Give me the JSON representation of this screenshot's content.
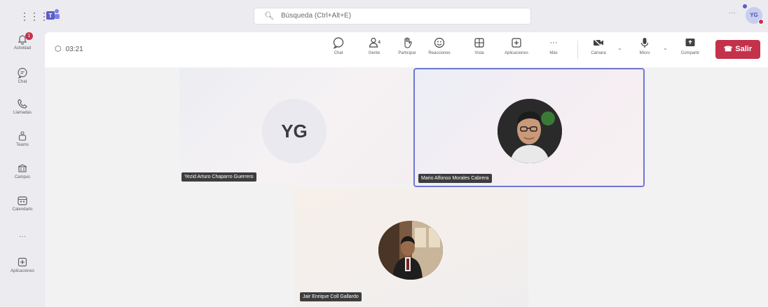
{
  "topbar": {
    "search_placeholder": "Búsqueda (Ctrl+Alt+E)",
    "more": "···",
    "user_initials": "YG"
  },
  "rail": {
    "items": [
      {
        "label": "Actividad",
        "icon": "bell-icon",
        "badge": "1"
      },
      {
        "label": "Chat",
        "icon": "chat-icon"
      },
      {
        "label": "Llamadas",
        "icon": "phone-icon"
      },
      {
        "label": "Teams",
        "icon": "teams-icon"
      },
      {
        "label": "Campus",
        "icon": "campus-icon"
      },
      {
        "label": "Calendario",
        "icon": "calendar-icon"
      },
      {
        "label": "···",
        "icon": "more-icon"
      },
      {
        "label": "Aplicaciones",
        "icon": "apps-icon"
      }
    ]
  },
  "meeting": {
    "timer": "03:21",
    "buttons": [
      {
        "label": "Chat",
        "icon": "chat-icon"
      },
      {
        "label": "Gente",
        "icon": "people-icon"
      },
      {
        "label": "Participar",
        "icon": "raise-hand-icon"
      },
      {
        "label": "Reacciones",
        "icon": "smiley-icon"
      },
      {
        "label": "Vista",
        "icon": "grid-view-icon"
      },
      {
        "label": "Aplicaciones",
        "icon": "add-app-icon"
      },
      {
        "label": "Más",
        "icon": "more-icon"
      },
      {
        "label": "Cámara",
        "icon": "camera-off-icon"
      },
      {
        "label": "Micro",
        "icon": "mic-icon"
      },
      {
        "label": "Compartir",
        "icon": "share-icon"
      }
    ],
    "leave_label": "Salir"
  },
  "participants": [
    {
      "name": "Yezid Arturo Chaparro Guerrero",
      "initials": "YG"
    },
    {
      "name": "Mario Alfonso Morales Cabrera"
    },
    {
      "name": "Jair Enrique Coll Gallardo"
    }
  ],
  "colors": {
    "leave": "#c4314b",
    "active_speaker_border": "#6f76d4",
    "brand": "#5b5fc7"
  }
}
